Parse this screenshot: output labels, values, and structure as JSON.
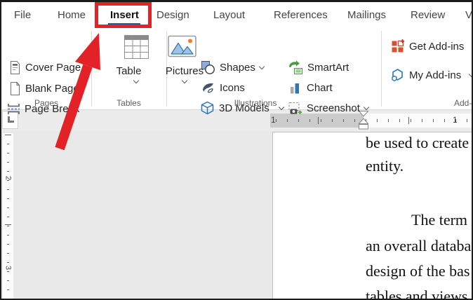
{
  "app": "Microsoft Word ribbon",
  "colors": {
    "annotation_red": "#e32227",
    "active_tab_underline": "#2b579a",
    "office_blue": "#2e75b6",
    "smartart_green": "#4e9a3c",
    "addin_orange": "#d35230"
  },
  "menu_tabs": {
    "file": "File",
    "home": "Home",
    "insert": "Insert",
    "design": "Design",
    "layout": "Layout",
    "references": "References",
    "mailings": "Mailings",
    "review": "Review",
    "view": "View",
    "active_tab": "Insert"
  },
  "ribbon": {
    "pages": {
      "cover_page": "Cover Page",
      "blank_page": "Blank Page",
      "page_break": "Page Break",
      "group_label": "Pages"
    },
    "tables": {
      "table": "Table",
      "group_label": "Tables"
    },
    "illustrations": {
      "pictures": "Pictures",
      "shapes": "Shapes",
      "icons": "Icons",
      "models_3d": "3D Models",
      "smartart": "SmartArt",
      "chart": "Chart",
      "screenshot": "Screenshot",
      "group_label": "Illustrations"
    },
    "addins": {
      "get_addins": "Get Add-ins",
      "my_addins": "My Add-ins",
      "group_label": "Add-ins"
    }
  },
  "ruler": {
    "h_left_label": "1",
    "h_right_label": "1",
    "v_labels": [
      "2",
      "3"
    ]
  },
  "document": {
    "lines": [
      "be used to create",
      "entity.",
      "The term",
      "an overall databa",
      "design of the bas",
      "tables and views"
    ]
  },
  "icons": [
    "cover-page-icon",
    "blank-page-icon",
    "page-break-icon",
    "table-icon",
    "pictures-icon",
    "shapes-icon",
    "icons-gallery-icon",
    "3d-models-icon",
    "smartart-icon",
    "chart-icon",
    "screenshot-icon",
    "get-add-ins-icon",
    "my-add-ins-icon",
    "chevron-down-icon",
    "tab-selector-icon",
    "red-arrow-annotation"
  ]
}
